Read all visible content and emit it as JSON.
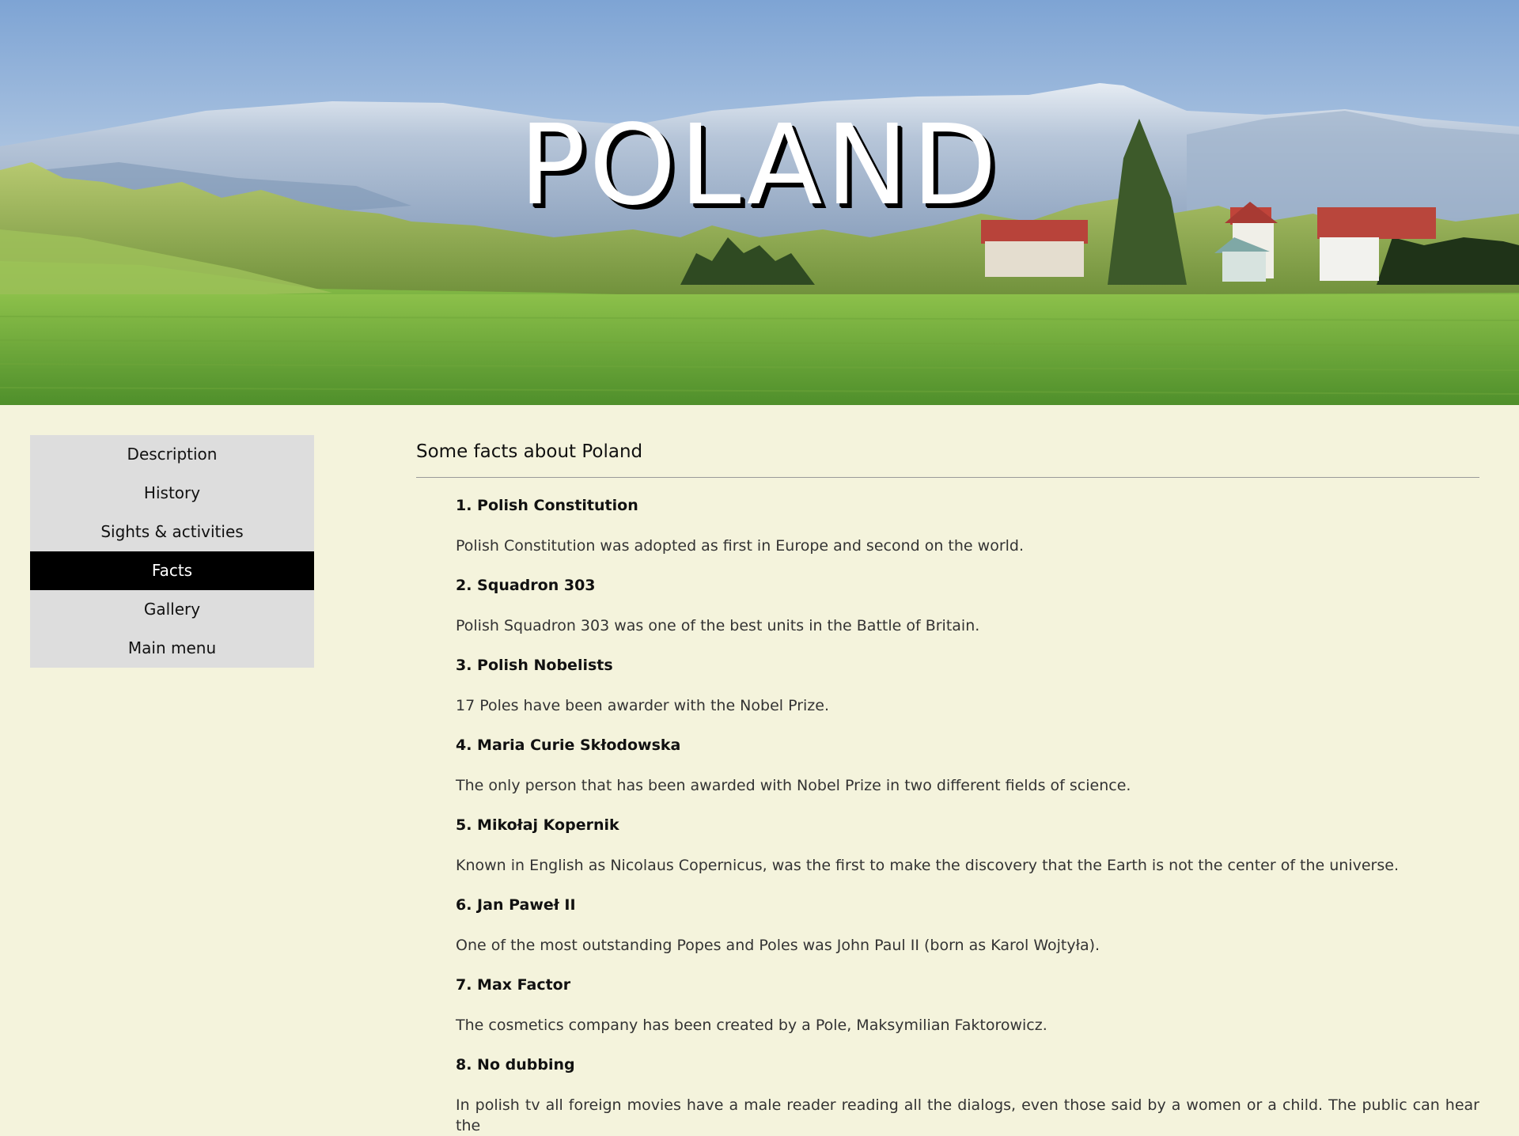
{
  "hero": {
    "title": "POLAND"
  },
  "sidebar": {
    "items": [
      {
        "label": "Description"
      },
      {
        "label": "History"
      },
      {
        "label": "Sights & activities"
      },
      {
        "label": "Facts"
      },
      {
        "label": "Gallery"
      },
      {
        "label": "Main menu"
      }
    ],
    "active_index": 3
  },
  "main": {
    "heading": "Some facts about Poland",
    "facts": [
      {
        "title": "1. Polish Constitution",
        "text": "Polish Constitution was adopted as first in Europe and second on the world."
      },
      {
        "title": "2. Squadron 303",
        "text": "Polish Squadron 303 was one of the best units in the Battle of Britain."
      },
      {
        "title": "3. Polish Nobelists",
        "text": "17 Poles have been awarder with the Nobel Prize."
      },
      {
        "title": "4. Maria Curie Skłodowska",
        "text": "The only person that has been awarded with Nobel Prize in two different fields of science."
      },
      {
        "title": "5. Mikołaj Kopernik",
        "text": "Known in English as Nicolaus Copernicus, was the first to make the discovery that the Earth is not the center of the universe."
      },
      {
        "title": "6. Jan Paweł II",
        "text": "One of the most outstanding Popes and Poles was John Paul II (born as Karol Wojtyła)."
      },
      {
        "title": "7. Max Factor",
        "text": "The cosmetics company has been created by a Pole, Maksymilian Faktorowicz."
      },
      {
        "title": "8. No dubbing",
        "text": "In polish tv all foreign movies have a male reader reading all the dialogs, even those said by a women or a child. The public can hear the"
      }
    ]
  },
  "colors": {
    "page_background": "#f4f3dc",
    "sidebar_background": "#dddddd",
    "sidebar_active_background": "#000000",
    "sidebar_active_text": "#ffffff"
  }
}
